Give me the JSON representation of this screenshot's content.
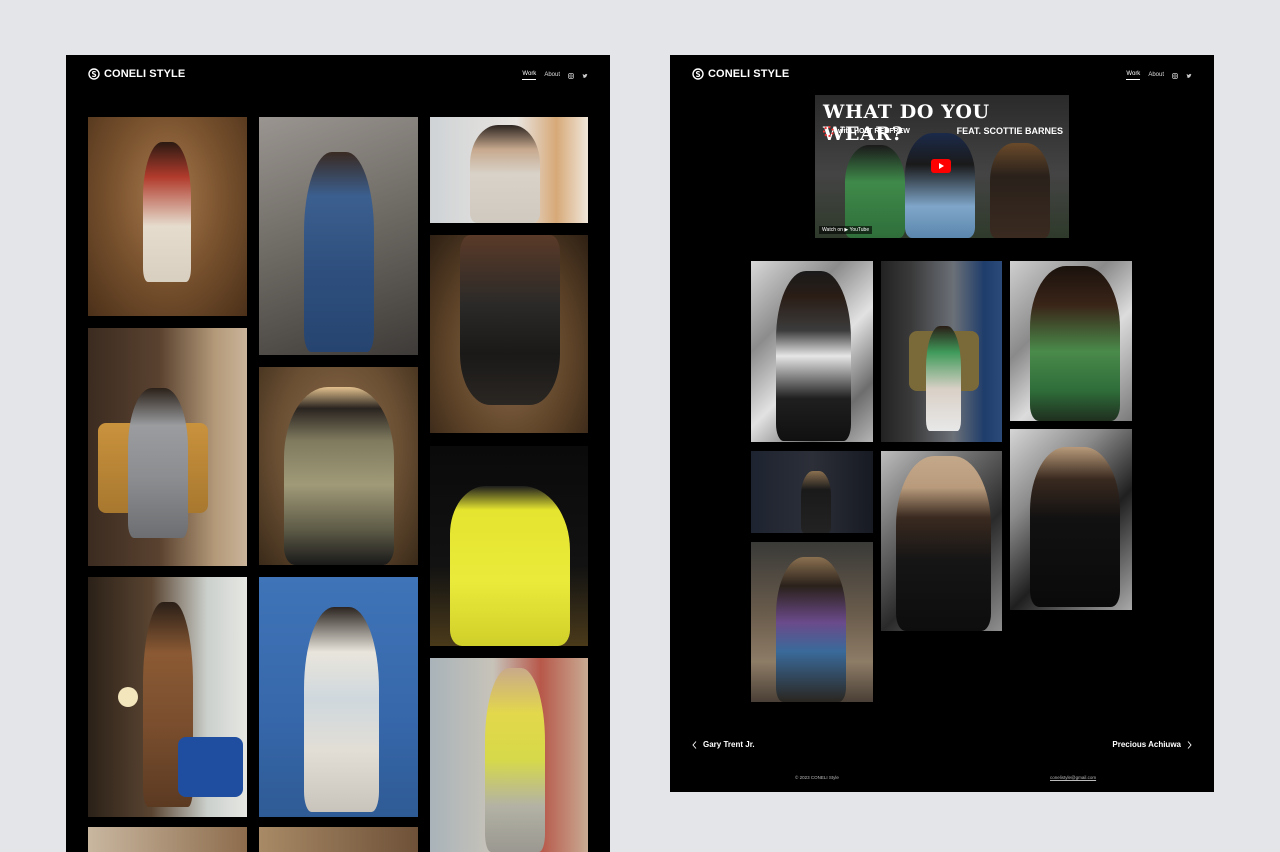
{
  "left_page": {
    "brand": "CONELI STYLE",
    "nav": {
      "work": "Work",
      "about": "About"
    },
    "social_icons": [
      "instagram-icon",
      "twitter-icon"
    ]
  },
  "right_page": {
    "brand": "CONELI STYLE",
    "nav": {
      "work": "Work",
      "about": "About"
    },
    "social_icons": [
      "instagram-icon",
      "twitter-icon"
    ],
    "video": {
      "title": "WHAT DO YOU WEAR?",
      "subtitle": "with HOLT RENFREW",
      "feature": "FEAT. SCOTTIE BARNES",
      "watch_on": "Watch on ▶ YouTube"
    },
    "pager": {
      "prev_label": "Gary Trent Jr.",
      "next_label": "Precious Achiuwa"
    },
    "footer": {
      "copyright": "© 2023 CONELI Style",
      "email": "conelistyle@gmail.com"
    }
  },
  "colors": {
    "page_background": "#000000",
    "canvas_background": "#e3e5e9",
    "text": "#ffffff",
    "play_button": "#ff0000"
  }
}
